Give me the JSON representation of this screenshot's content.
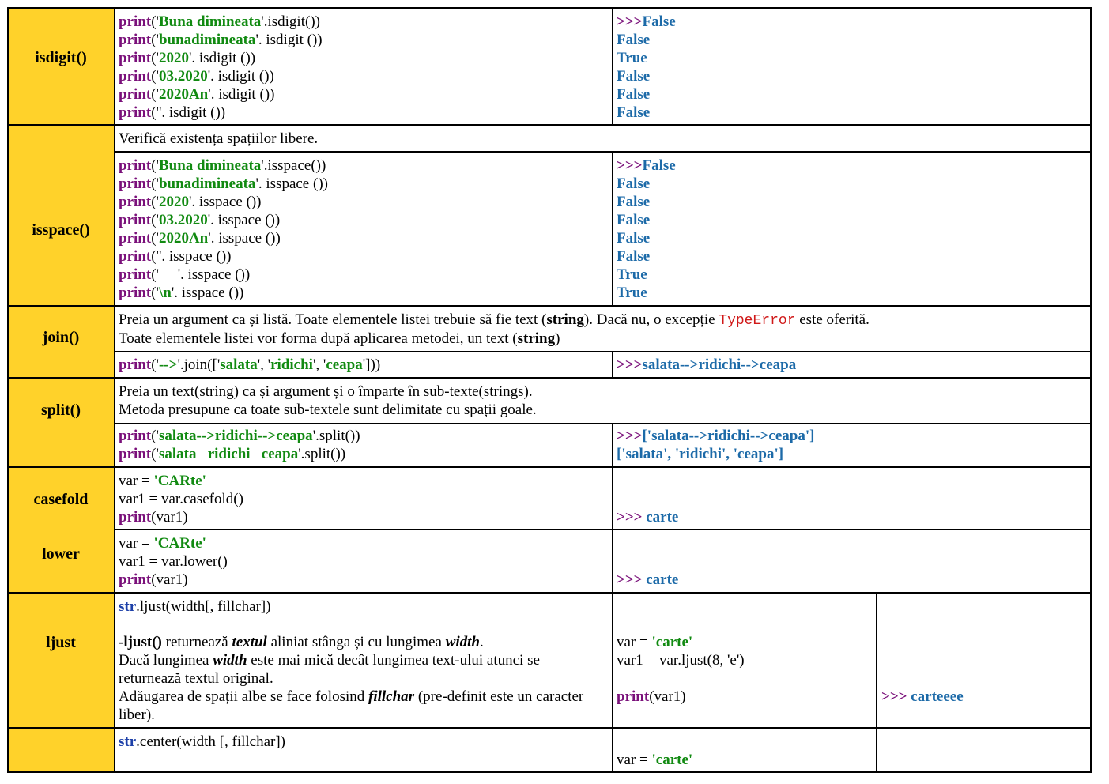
{
  "colors": {
    "label_bg": "#ffd22a",
    "keyword": "#7a107a",
    "string": "#118a11",
    "output": "#1c6aa8",
    "error": "#d01818"
  },
  "tokens": {
    "print": "print",
    "str": "str",
    "prompt": ">>>",
    "open": "('",
    "close_paren": "()"
  },
  "isdigit": {
    "label": "isdigit()",
    "code": [
      {
        "s": "Buna dimineata",
        "m": ".isdigit())"
      },
      {
        "s": "bunadimineata",
        "m": ". isdigit ())"
      },
      {
        "s": "2020",
        "m": ". isdigit ())"
      },
      {
        "s": "03.2020",
        "m": ". isdigit ())"
      },
      {
        "s": "2020An",
        "m": ". isdigit ())"
      },
      {
        "s": "",
        "m": "'. isdigit ())"
      }
    ],
    "out": [
      "False",
      "False",
      "True",
      "False",
      "False",
      "False"
    ]
  },
  "isspace": {
    "label": "isspace()",
    "desc": "Verifică existența spațiilor libere.",
    "code": [
      {
        "s": "Buna dimineata",
        "m": ".isspace())"
      },
      {
        "s": "bunadimineata",
        "m": ". isspace ())"
      },
      {
        "s": "2020",
        "m": ". isspace ())"
      },
      {
        "s": "03.2020",
        "m": ". isspace ())"
      },
      {
        "s": "2020An",
        "m": ". isspace ())"
      },
      {
        "s": "",
        "m": "'. isspace ())"
      },
      {
        "s": "",
        "m": "     '. isspace ())"
      },
      {
        "s": "\\n",
        "m": ". isspace ())"
      }
    ],
    "out": [
      "False",
      "False",
      "False",
      "False",
      "False",
      "False",
      "True",
      "True"
    ]
  },
  "join": {
    "label": "join()",
    "desc1_a": "Preia un argument ca și listă. Toate elementele listei trebuie să fie text (",
    "desc1_b": "string",
    "desc1_c": "). Dacă nu, o excepție ",
    "desc1_err": "TypeError",
    "desc1_d": " este oferită.",
    "desc2_a": "Toate elementele listei vor forma după aplicarea metodei, un text (",
    "desc2_b": "string",
    "desc2_c": ")",
    "code_a": "('",
    "code_sep": "-->",
    "code_b": "'.join(['",
    "items": [
      "salata",
      "ridichi",
      "ceapa"
    ],
    "code_comma": "', '",
    "code_end": "']))",
    "out": "salata-->ridichi-->ceapa"
  },
  "split": {
    "label": "split()",
    "desc1": "Preia un text(string) ca și argument și o împarte în sub-texte(strings).",
    "desc2": "Metoda presupune ca toate sub-textele sunt delimitate cu spații goale.",
    "code": [
      {
        "s": "salata-->ridichi-->ceapa",
        "m": ".split())"
      },
      {
        "s": "salata   ridichi   ceapa",
        "m": ".split())"
      }
    ],
    "out": [
      "['salata-->ridichi-->ceapa']",
      "['salata', 'ridichi', 'ceapa']"
    ]
  },
  "casefold": {
    "label": "casefold",
    "l1_a": "var = ",
    "l1_s": "'CARte'",
    "l2": "var1 = var.casefold()",
    "l3_arg": "(var1)",
    "out": " carte"
  },
  "lower": {
    "label": "lower",
    "l1_a": "var = ",
    "l1_s": "'CARte'",
    "l2": "var1 = var.lower()",
    "l3_arg": "(var1)",
    "out": " carte"
  },
  "ljust": {
    "label": "ljust",
    "sig": ".ljust(width[, fillchar])",
    "d1_a": "-ljust()",
    "d1_b": " returnează ",
    "d1_c": "textul",
    "d1_d": " aliniat stânga și cu lungimea ",
    "d1_e": "width",
    "d1_f": ".",
    "d2_a": "Dacă lungimea ",
    "d2_b": "width",
    "d2_c": " este mai mică decât lungimea text-ului atunci se",
    "d3": "returnează textul original.",
    "d4_a": "Adăugarea de spații albe se face folosind ",
    "d4_b": "fillchar",
    "d4_c": " (pre-definit este un caracter",
    "d5": "liber).",
    "c1_a": "var = ",
    "c1_s": "'carte'",
    "c2": "var1 = var.ljust(8, 'e')",
    "c3_arg": "(var1)",
    "out": " carteeee"
  },
  "center": {
    "sig": ".center(width [, fillchar])",
    "c1_a": "var = ",
    "c1_s": "'carte'"
  }
}
